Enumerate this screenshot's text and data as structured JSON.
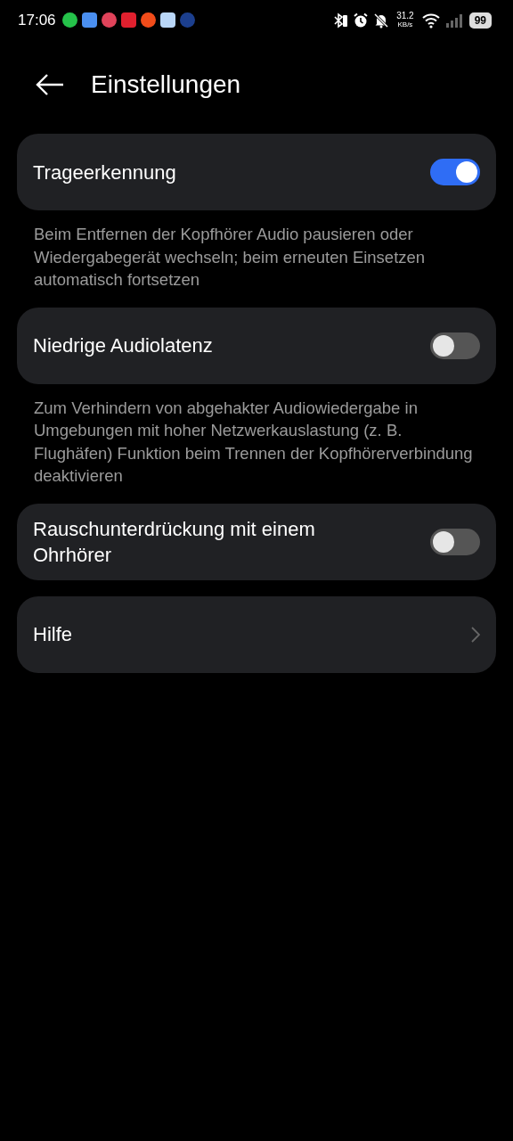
{
  "status_bar": {
    "time": "17:06",
    "speed_value": "31.2",
    "speed_unit": "KB/s",
    "battery": "99"
  },
  "header": {
    "title": "Einstellungen"
  },
  "settings": [
    {
      "kind": "toggle",
      "title": "Trageerkennung",
      "on": true,
      "description": "Beim Entfernen der Kopfhörer Audio pausieren oder Wiedergabegerät wechseln; beim erneuten Einsetzen automatisch fortsetzen"
    },
    {
      "kind": "toggle",
      "title": "Niedrige Audiolatenz",
      "on": false,
      "description": "Zum Verhindern von abgehakter Audiowiedergabe in Umgebungen mit hoher Netzwerkauslastung (z. B. Flughäfen) Funktion beim Trennen der Kopfhörerverbindung deaktivieren"
    },
    {
      "kind": "toggle",
      "title": "Rauschunterdrückung mit einem Ohrhörer",
      "on": false
    },
    {
      "kind": "link",
      "title": "Hilfe"
    }
  ]
}
